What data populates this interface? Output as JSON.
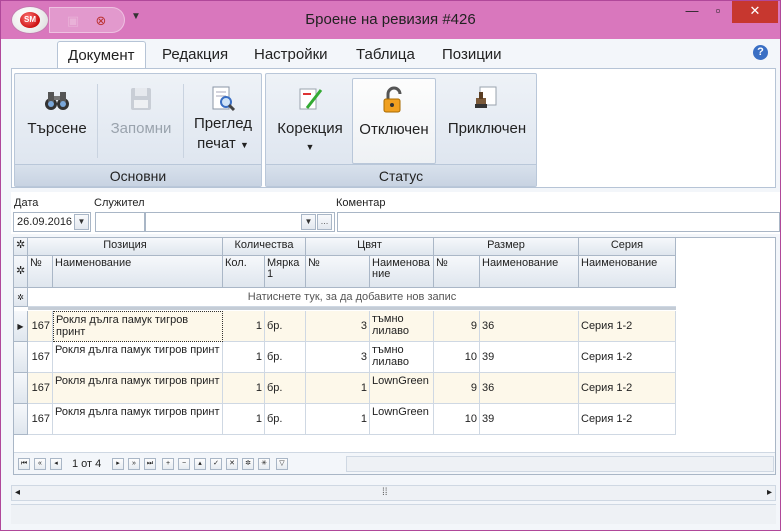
{
  "window": {
    "title": "Броене на ревизия #426"
  },
  "qat": {
    "orb_label": "SM"
  },
  "ribbon_tabs": [
    "Документ",
    "Редакция",
    "Настройки",
    "Таблица",
    "Позиции"
  ],
  "groups": {
    "basic": {
      "label": "Основни",
      "buttons": [
        {
          "label": "Търсене",
          "icon": "binoculars-icon"
        },
        {
          "label": "Запомни",
          "icon": "save-icon"
        },
        {
          "label": "Преглед",
          "label2": "печат",
          "icon": "print-preview-icon"
        }
      ]
    },
    "status": {
      "label": "Статус",
      "buttons": [
        {
          "label": "Корекция",
          "icon": "correction-icon"
        },
        {
          "label": "Отключен",
          "icon": "unlock-icon"
        },
        {
          "label": "Приключен",
          "icon": "stamp-icon"
        }
      ]
    }
  },
  "form": {
    "date_label": "Дата",
    "date_value": "26.09.2016",
    "employee_label": "Служител",
    "comment_label": "Коментар"
  },
  "grid": {
    "bands": [
      "Позиция",
      "Количества",
      "Цвят",
      "Размер",
      "Серия"
    ],
    "columns": [
      "№",
      "Наименование",
      "Кол.",
      "Мярка 1",
      "№",
      "Наименова ние",
      "№",
      "Наименование",
      "Наименование"
    ],
    "new_row_text": "Натиснете тук, за да добавите нов запис",
    "rows": [
      {
        "no": "167",
        "name": "Рокля дълга памук тигров принт",
        "qty": "1",
        "unit": "бр.",
        "color_no": "3",
        "color": "тъмно лилаво",
        "size_no": "9",
        "size": "36",
        "series": "Серия 1-2"
      },
      {
        "no": "167",
        "name": "Рокля дълга памук тигров принт",
        "qty": "1",
        "unit": "бр.",
        "color_no": "3",
        "color": "тъмно лилаво",
        "size_no": "10",
        "size": "39",
        "series": "Серия 1-2"
      },
      {
        "no": "167",
        "name": "Рокля дълга памук тигров принт",
        "qty": "1",
        "unit": "бр.",
        "color_no": "1",
        "color": "LownGreen",
        "size_no": "9",
        "size": "36",
        "series": "Серия 1-2"
      },
      {
        "no": "167",
        "name": "Рокля дълга памук тигров принт",
        "qty": "1",
        "unit": "бр.",
        "color_no": "1",
        "color": "LownGreen",
        "size_no": "10",
        "size": "39",
        "series": "Серия 1-2"
      }
    ],
    "navigator": {
      "record_text": "1 от 4"
    }
  },
  "colors": {
    "titlebar": "#d977bd",
    "row_alt": "#fdf8ea",
    "selected_cell_border": "#333333"
  }
}
